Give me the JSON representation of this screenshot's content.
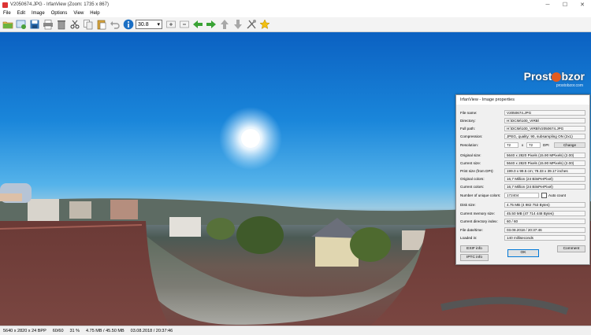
{
  "window": {
    "title": "V2050674.JPG - IrfanView (Zoom: 1735 x 867)",
    "minimize": "─",
    "maximize": "☐",
    "close": "✕"
  },
  "menu": [
    "File",
    "Edit",
    "Image",
    "Options",
    "View",
    "Help"
  ],
  "toolbar": {
    "zoom_value": "30.8",
    "icons": [
      "open-folder-icon",
      "slideshow-icon",
      "save-icon",
      "print-icon",
      "delete-icon",
      "cut-icon",
      "copy-icon",
      "paste-icon",
      "undo-icon",
      "info-icon",
      "zoom-in-icon",
      "zoom-out-icon",
      "prev-arrow-icon",
      "next-arrow-icon",
      "up-arrow-icon",
      "down-arrow-icon",
      "tools-icon",
      "star-icon"
    ]
  },
  "watermark": {
    "brand_a": "Prost",
    "brand_b": "bzor",
    "site": "prostobzor.com"
  },
  "dialog": {
    "title": "IrfanView - Image properties",
    "fields": [
      {
        "label": "File name:",
        "value": "V2050674.JPG"
      },
      {
        "label": "Directory:",
        "value": "H:\\DCIM\\100_VIRB\\"
      },
      {
        "label": "Full path:",
        "value": "H:\\DCIM\\100_VIRB\\V2050674.JPG"
      },
      {
        "label": "Compression:",
        "value": "JPEG, quality: 90, subsampling ON (2x1)"
      }
    ],
    "resolution": {
      "label": "Resolution:",
      "x": "72",
      "sep": "x",
      "y": "72",
      "unit": "DPI",
      "change": "Change"
    },
    "fields2": [
      {
        "label": "Original size:",
        "value": "5640 x 2820  Pixels (15.90 MPixels) (2.00)"
      },
      {
        "label": "Current size:",
        "value": "5640 x 2820  Pixels (15.90 MPixels) (2.00)"
      },
      {
        "label": "Print size (from DPI):",
        "value": "199.0 x 99.5 cm; 78.33 x 39.17 inches"
      },
      {
        "label": "Original colors:",
        "value": "16,7 Million   (24 BitsPerPixel)"
      },
      {
        "label": "Current colors:",
        "value": "16,7 Million   (24 BitsPerPixel)"
      }
    ],
    "unique": {
      "label": "Number of unique colors:",
      "value": "172404",
      "auto_count": "Auto count"
    },
    "fields3": [
      {
        "label": "Disk size:",
        "value": "4.75 MB (4 982 753 Bytes)"
      },
      {
        "label": "Current memory size:",
        "value": "45.50  MB (47 714 448 Bytes)"
      },
      {
        "label": "Current directory index:",
        "value": "60  /  60"
      },
      {
        "label": "File date/time:",
        "value": "03.08.2018 / 20:37:46"
      },
      {
        "label": "Loaded in:",
        "value": "140 milliseconds"
      }
    ],
    "buttons": {
      "exif": "EXIF info",
      "iptc": "IPTC info",
      "ok": "OK",
      "comment": "Comment"
    }
  },
  "status": [
    "5640 x 2820 x 24 BPP",
    "60/60",
    "31 %",
    "4.75 MB / 45.50 MB",
    "03.08.2018 / 20:37:46"
  ]
}
